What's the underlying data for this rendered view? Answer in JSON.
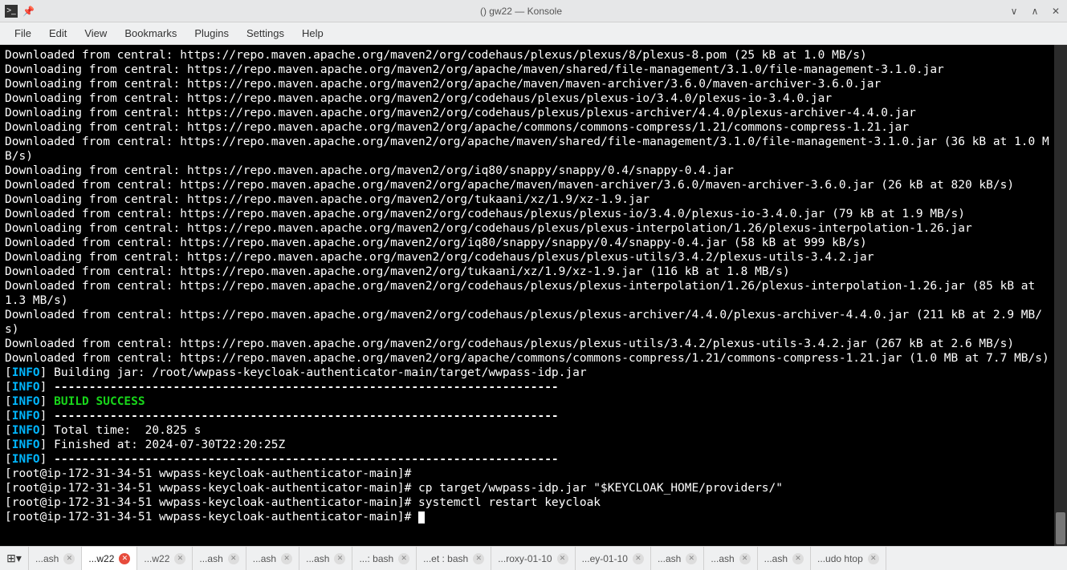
{
  "window": {
    "title": "() gw22 — Konsole"
  },
  "menu": [
    "File",
    "Edit",
    "View",
    "Bookmarks",
    "Plugins",
    "Settings",
    "Help"
  ],
  "terminal": {
    "plain_lines": [
      "Downloaded from central: https://repo.maven.apache.org/maven2/org/codehaus/plexus/plexus/8/plexus-8.pom (25 kB at 1.0 MB/s)",
      "Downloading from central: https://repo.maven.apache.org/maven2/org/apache/maven/shared/file-management/3.1.0/file-management-3.1.0.jar",
      "Downloading from central: https://repo.maven.apache.org/maven2/org/apache/maven/maven-archiver/3.6.0/maven-archiver-3.6.0.jar",
      "Downloading from central: https://repo.maven.apache.org/maven2/org/codehaus/plexus/plexus-io/3.4.0/plexus-io-3.4.0.jar",
      "Downloading from central: https://repo.maven.apache.org/maven2/org/codehaus/plexus/plexus-archiver/4.4.0/plexus-archiver-4.4.0.jar",
      "Downloading from central: https://repo.maven.apache.org/maven2/org/apache/commons/commons-compress/1.21/commons-compress-1.21.jar",
      "Downloaded from central: https://repo.maven.apache.org/maven2/org/apache/maven/shared/file-management/3.1.0/file-management-3.1.0.jar (36 kB at 1.0 MB/s)",
      "Downloading from central: https://repo.maven.apache.org/maven2/org/iq80/snappy/snappy/0.4/snappy-0.4.jar",
      "Downloaded from central: https://repo.maven.apache.org/maven2/org/apache/maven/maven-archiver/3.6.0/maven-archiver-3.6.0.jar (26 kB at 820 kB/s)",
      "Downloading from central: https://repo.maven.apache.org/maven2/org/tukaani/xz/1.9/xz-1.9.jar",
      "Downloaded from central: https://repo.maven.apache.org/maven2/org/codehaus/plexus/plexus-io/3.4.0/plexus-io-3.4.0.jar (79 kB at 1.9 MB/s)",
      "Downloading from central: https://repo.maven.apache.org/maven2/org/codehaus/plexus/plexus-interpolation/1.26/plexus-interpolation-1.26.jar",
      "Downloaded from central: https://repo.maven.apache.org/maven2/org/iq80/snappy/snappy/0.4/snappy-0.4.jar (58 kB at 999 kB/s)",
      "Downloading from central: https://repo.maven.apache.org/maven2/org/codehaus/plexus/plexus-utils/3.4.2/plexus-utils-3.4.2.jar",
      "Downloaded from central: https://repo.maven.apache.org/maven2/org/tukaani/xz/1.9/xz-1.9.jar (116 kB at 1.8 MB/s)",
      "Downloaded from central: https://repo.maven.apache.org/maven2/org/codehaus/plexus/plexus-interpolation/1.26/plexus-interpolation-1.26.jar (85 kB at 1.3 MB/s)",
      "Downloaded from central: https://repo.maven.apache.org/maven2/org/codehaus/plexus/plexus-archiver/4.4.0/plexus-archiver-4.4.0.jar (211 kB at 2.9 MB/s)",
      "Downloaded from central: https://repo.maven.apache.org/maven2/org/codehaus/plexus/plexus-utils/3.4.2/plexus-utils-3.4.2.jar (267 kB at 2.6 MB/s)",
      "Downloaded from central: https://repo.maven.apache.org/maven2/org/apache/commons/commons-compress/1.21/commons-compress-1.21.jar (1.0 MB at 7.7 MB/s)"
    ],
    "info_lines": {
      "build_jar": "Building jar: /root/wwpass-keycloak-authenticator-main/target/wwpass-idp.jar",
      "dashes": "------------------------------------------------------------------------",
      "success": "BUILD SUCCESS",
      "total_time": "Total time:  20.825 s",
      "finished_at": "Finished at: 2024-07-30T22:20:25Z"
    },
    "prompt": "[root@ip-172-31-34-51 wwpass-keycloak-authenticator-main]# ",
    "cmd_cp": "cp target/wwpass-idp.jar \"$KEYCLOAK_HOME/providers/\"",
    "cmd_restart": "systemctl restart keycloak"
  },
  "tabs": [
    {
      "label": "...ash",
      "active": false
    },
    {
      "label": "...w22",
      "active": true
    },
    {
      "label": "...w22",
      "active": false
    },
    {
      "label": "...ash",
      "active": false
    },
    {
      "label": "...ash",
      "active": false
    },
    {
      "label": "...ash",
      "active": false
    },
    {
      "label": "...: bash",
      "active": false
    },
    {
      "label": "...et : bash",
      "active": false
    },
    {
      "label": "...roxy-01-10",
      "active": false
    },
    {
      "label": "...ey-01-10",
      "active": false
    },
    {
      "label": "...ash",
      "active": false
    },
    {
      "label": "...ash",
      "active": false
    },
    {
      "label": "...ash",
      "active": false
    },
    {
      "label": "...udo htop",
      "active": false
    }
  ]
}
